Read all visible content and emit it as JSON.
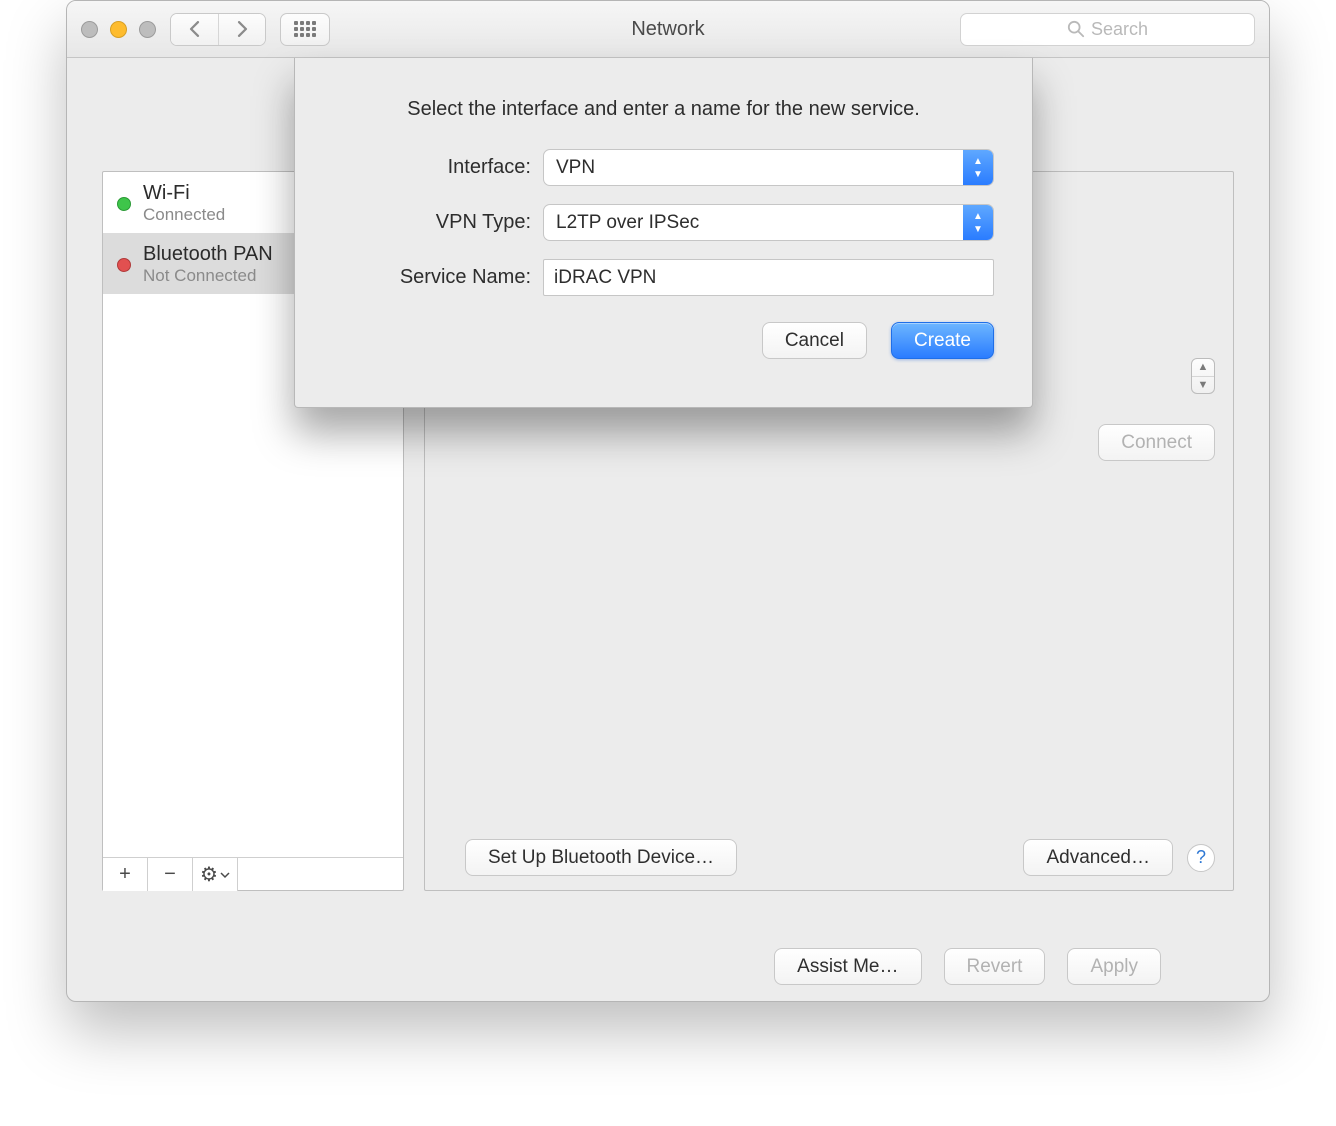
{
  "window_title": "Network",
  "toolbar": {
    "search_placeholder": "Search"
  },
  "sidebar": {
    "items": [
      {
        "name": "Wi-Fi",
        "status": "Connected",
        "color": "green",
        "selected": false
      },
      {
        "name": "Bluetooth PAN",
        "status": "Not Connected",
        "color": "red",
        "selected": true
      }
    ],
    "add_label": "+",
    "remove_label": "−",
    "gear_label": "⚙︎"
  },
  "detail": {
    "connect_label": "Connect",
    "setup_label": "Set Up Bluetooth Device…",
    "advanced_label": "Advanced…",
    "help_label": "?"
  },
  "footer": {
    "assist_label": "Assist Me…",
    "revert_label": "Revert",
    "apply_label": "Apply"
  },
  "sheet": {
    "prompt": "Select the interface and enter a name for the new service.",
    "interface_label": "Interface:",
    "interface_value": "VPN",
    "vpn_type_label": "VPN Type:",
    "vpn_type_value": "L2TP over IPSec",
    "service_name_label": "Service Name:",
    "service_name_value": "iDRAC VPN",
    "cancel_label": "Cancel",
    "create_label": "Create"
  }
}
